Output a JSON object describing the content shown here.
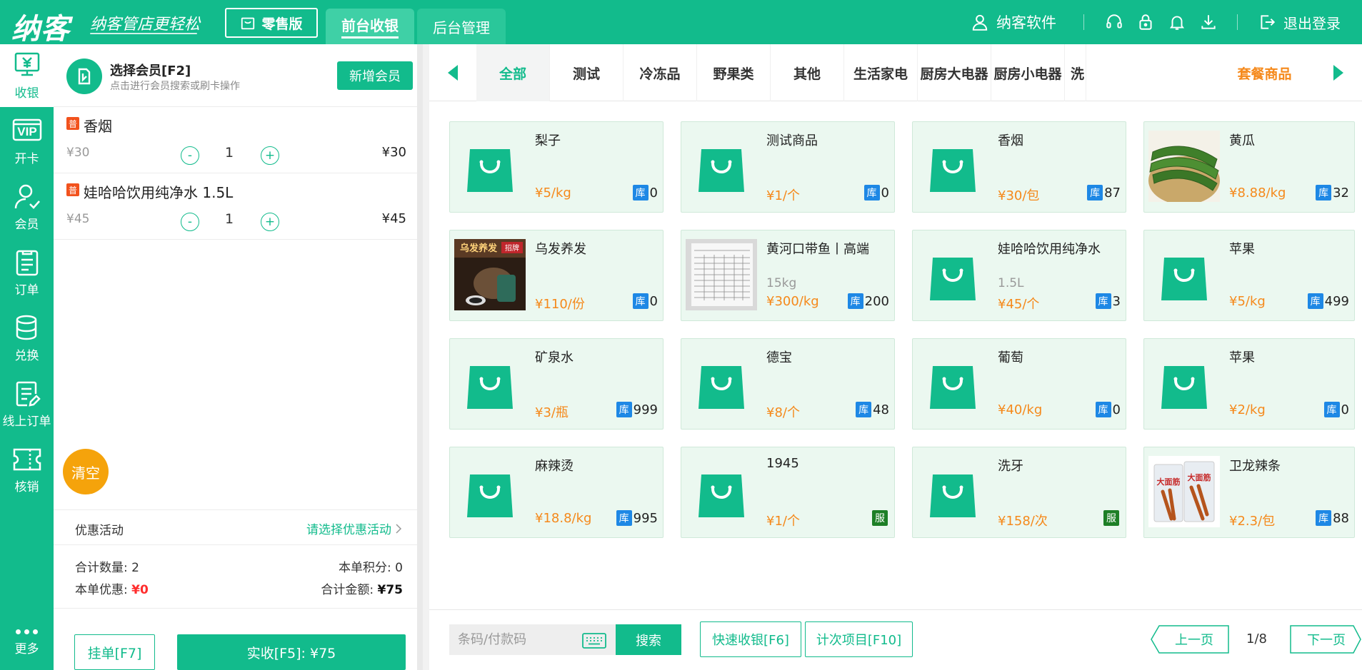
{
  "header": {
    "logo": "纳客",
    "slogan": "纳客管店更轻松",
    "edition": "零售版",
    "tabs": [
      {
        "label": "前台收银",
        "active": true
      },
      {
        "label": "后台管理",
        "active": false
      }
    ],
    "user_name": "纳客软件",
    "logout": "退出登录"
  },
  "nav": {
    "items": [
      "收银",
      "开卡",
      "会员",
      "订单",
      "兑换",
      "线上订单",
      "核销"
    ],
    "more": "更多"
  },
  "member": {
    "title": "选择会员[F2]",
    "subtitle": "点击进行会员搜索或刷卡操作",
    "add_button": "新增会员"
  },
  "cart": {
    "items": [
      {
        "badge": "普",
        "name": "香烟",
        "unit_price": "¥30",
        "qty": "1",
        "total": "¥30"
      },
      {
        "badge": "普",
        "name": "娃哈哈饮用纯净水 1.5L",
        "unit_price": "¥45",
        "qty": "1",
        "total": "¥45"
      }
    ],
    "minus": "-",
    "plus": "+",
    "clear": "清空",
    "promo_label": "优惠活动",
    "promo_link": "请选择优惠活动",
    "total_qty_label": "合计数量:",
    "total_qty": "2",
    "points_label": "本单积分:",
    "points": "0",
    "discount_label": "本单优惠:",
    "discount": "¥0",
    "amount_label": "合计金额:",
    "amount": "¥75",
    "hold_button": "挂单[F7]",
    "pay_button": "实收[F5]: ¥75"
  },
  "categories": [
    "全部",
    "测试",
    "冷冻品",
    "野果类",
    "其他",
    "生活家电",
    "厨房大电器",
    "厨房小电器",
    "洗"
  ],
  "combo_category": "套餐商品",
  "products": [
    {
      "name": "梨子",
      "spec": "",
      "price": "¥5/kg",
      "tag": "库",
      "stock": "0",
      "image": "bag"
    },
    {
      "name": "测试商品",
      "spec": "",
      "price": "¥1/个",
      "tag": "库",
      "stock": "0",
      "image": "bag"
    },
    {
      "name": "香烟",
      "spec": "",
      "price": "¥30/包",
      "tag": "库",
      "stock": "87",
      "image": "bag"
    },
    {
      "name": "黄瓜",
      "spec": "",
      "price": "¥8.88/kg",
      "tag": "库",
      "stock": "32",
      "image": "cucumber"
    },
    {
      "name": "乌发养发",
      "spec": "",
      "price": "¥110/份",
      "tag": "库",
      "stock": "0",
      "image": "hair"
    },
    {
      "name": "黄河口带鱼丨高端",
      "spec": "15kg",
      "price": "¥300/kg",
      "tag": "库",
      "stock": "200",
      "image": "doc"
    },
    {
      "name": "娃哈哈饮用纯净水",
      "spec": "1.5L",
      "price": "¥45/个",
      "tag": "库",
      "stock": "3",
      "image": "bag"
    },
    {
      "name": "苹果",
      "spec": "",
      "price": "¥5/kg",
      "tag": "库",
      "stock": "499",
      "image": "bag"
    },
    {
      "name": "矿泉水",
      "spec": "",
      "price": "¥3/瓶",
      "tag": "库",
      "stock": "999",
      "image": "bag"
    },
    {
      "name": "德宝",
      "spec": "",
      "price": "¥8/个",
      "tag": "库",
      "stock": "48",
      "image": "bag"
    },
    {
      "name": "葡萄",
      "spec": "",
      "price": "¥40/kg",
      "tag": "库",
      "stock": "0",
      "image": "bag"
    },
    {
      "name": "苹果",
      "spec": "",
      "price": "¥2/kg",
      "tag": "库",
      "stock": "0",
      "image": "bag"
    },
    {
      "name": "麻辣烫",
      "spec": "",
      "price": "¥18.8/kg",
      "tag": "库",
      "stock": "995",
      "image": "bag"
    },
    {
      "name": "1945",
      "spec": "",
      "price": "¥1/个",
      "tag": "服",
      "stock": "",
      "image": "bag"
    },
    {
      "name": "洗牙",
      "spec": "",
      "price": "¥158/次",
      "tag": "服",
      "stock": "",
      "image": "bag"
    },
    {
      "name": "卫龙辣条",
      "spec": "",
      "price": "¥2.3/包",
      "tag": "库",
      "stock": "88",
      "image": "spicy"
    }
  ],
  "image_text": {
    "hair_title": "乌发养发",
    "hair_badge": "招牌",
    "spicy_brand": "大面筋"
  },
  "footer": {
    "scan_placeholder": "条码/付款码",
    "search": "搜索",
    "quick_checkout": "快速收银[F6]",
    "count_items": "计次项目[F10]",
    "prev": "上一页",
    "page": "1/8",
    "next": "下一页"
  },
  "colors": {
    "primary": "#12bb8c",
    "price": "#f5891b",
    "stock_badge": "#1e88e5",
    "service_badge": "#1d7f26",
    "clear": "#f5a30b",
    "discount": "#ff2d2d"
  }
}
